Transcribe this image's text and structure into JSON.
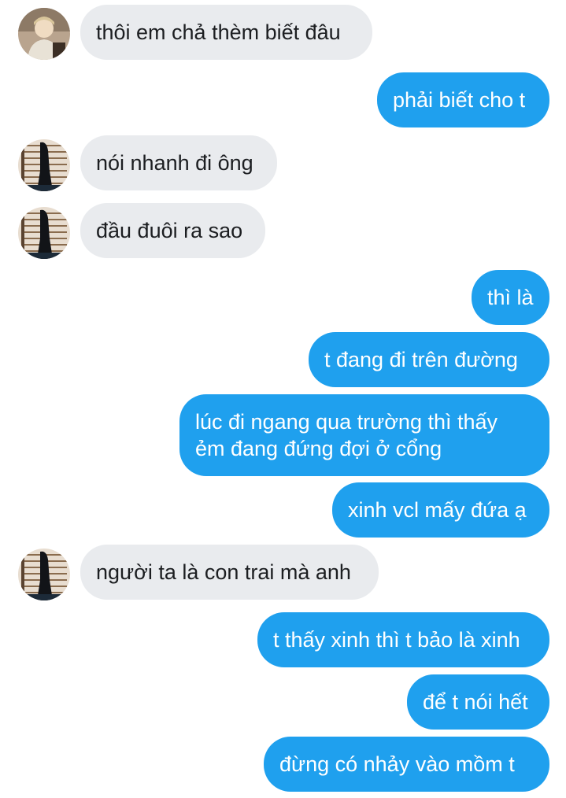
{
  "conversation": {
    "messages": [
      {
        "sender": "other",
        "text": "thôi em chả thèm biết đâu"
      },
      {
        "sender": "me",
        "text": "phải biết cho t"
      },
      {
        "sender": "other",
        "text": "nói nhanh đi ông"
      },
      {
        "sender": "other",
        "text": "đầu đuôi ra sao"
      },
      {
        "sender": "me",
        "text": "thì là"
      },
      {
        "sender": "me",
        "text": "t đang đi trên đường"
      },
      {
        "sender": "me",
        "text": "lúc đi ngang qua trường thì thấy ẻm đang đứng đợi ở cổng"
      },
      {
        "sender": "me",
        "text": "xinh vcl mấy đứa ạ"
      },
      {
        "sender": "other",
        "text": "người ta là con trai mà anh"
      },
      {
        "sender": "me",
        "text": "t thấy xinh thì t bảo là xinh"
      },
      {
        "sender": "me",
        "text": "để t nói hết"
      },
      {
        "sender": "me",
        "text": "đừng có nhảy vào mồm t"
      }
    ]
  },
  "colors": {
    "incoming_bubble": "#e9ebee",
    "outgoing_bubble": "#1fa0ee",
    "background": "#ffffff"
  },
  "icons": {
    "avatar_1": "person-photo-avatar",
    "avatar_2": "window-blinds-silhouette-avatar"
  }
}
